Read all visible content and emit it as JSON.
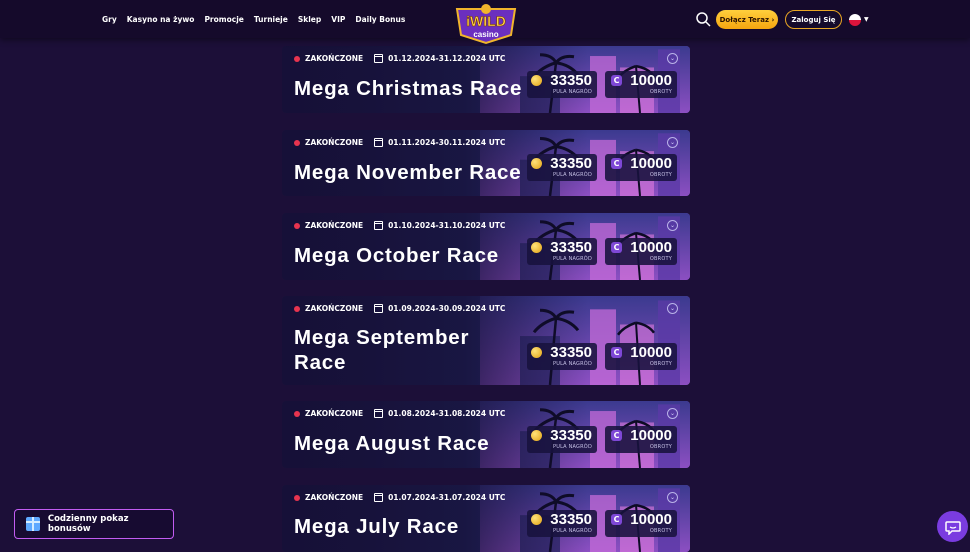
{
  "header": {
    "nav": [
      "Gry",
      "Kasyno na żywo",
      "Promocje",
      "Turnieje",
      "Sklep",
      "VIP",
      "Daily Bonus"
    ],
    "logo_text": "iWILD casino",
    "join_label": "Dołącz Teraz ›",
    "login_label": "Zaloguj Się",
    "language": "PL"
  },
  "races": [
    {
      "status": "ZAKOŃCZONE",
      "dates": "01.12.2024-31.12.2024 UTC",
      "title": "Mega Christmas Race",
      "pool": "33350",
      "pool_label": "PULA NAGRÓD",
      "spins": "10000",
      "spins_label": "OBROTY"
    },
    {
      "status": "ZAKOŃCZONE",
      "dates": "01.11.2024-30.11.2024 UTC",
      "title": "Mega November Race",
      "pool": "33350",
      "pool_label": "PULA NAGRÓD",
      "spins": "10000",
      "spins_label": "OBROTY"
    },
    {
      "status": "ZAKOŃCZONE",
      "dates": "01.10.2024-31.10.2024 UTC",
      "title": "Mega October Race",
      "pool": "33350",
      "pool_label": "PULA NAGRÓD",
      "spins": "10000",
      "spins_label": "OBROTY"
    },
    {
      "status": "ZAKOŃCZONE",
      "dates": "01.09.2024-30.09.2024 UTC",
      "title": "Mega September Race",
      "pool": "33350",
      "pool_label": "PULA NAGRÓD",
      "spins": "10000",
      "spins_label": "OBROTY"
    },
    {
      "status": "ZAKOŃCZONE",
      "dates": "01.08.2024-31.08.2024 UTC",
      "title": "Mega August Race",
      "pool": "33350",
      "pool_label": "PULA NAGRÓD",
      "spins": "10000",
      "spins_label": "OBROTY"
    },
    {
      "status": "ZAKOŃCZONE",
      "dates": "01.07.2024-31.07.2024 UTC",
      "title": "Mega July Race",
      "pool": "33350",
      "pool_label": "PULA NAGRÓD",
      "spins": "10000",
      "spins_label": "OBROTY"
    }
  ],
  "bonus_bar": {
    "label": "Codzienny pokaz bonusów"
  },
  "colors": {
    "background": "#1c0f38",
    "header": "#150a2b",
    "accent": "#f5a50f",
    "status_dot": "#e8344f",
    "spins_icon": "#7e48d6"
  },
  "icons": {
    "search": "search-icon",
    "calendar": "calendar-icon",
    "coin": "coin-icon",
    "spins": "spins-icon",
    "gift": "gift-icon",
    "chat": "chat-icon",
    "chevron": "chevron-down-icon"
  }
}
